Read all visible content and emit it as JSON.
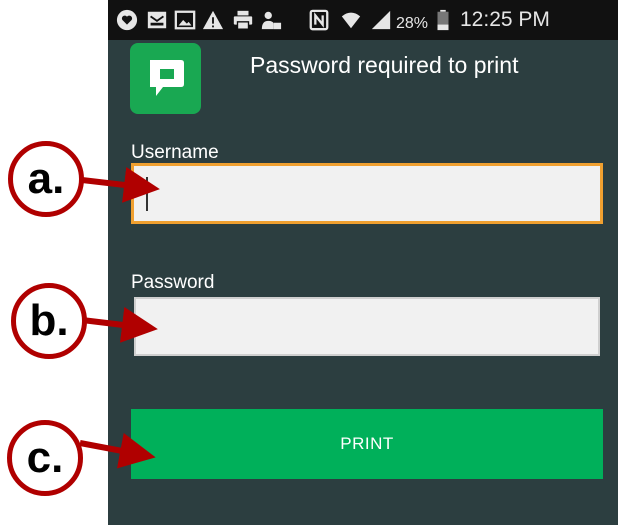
{
  "status_bar": {
    "battery": "28%",
    "time": "12:25 PM",
    "icons": [
      "heart-icon",
      "mail-icon",
      "gallery-icon",
      "warning-icon",
      "printer-icon",
      "lock-icon",
      "nfc-icon",
      "wifi-icon",
      "signal-icon",
      "battery-icon"
    ]
  },
  "dialog": {
    "title": "Password required to print",
    "username_label": "Username",
    "username_value": "",
    "password_label": "Password",
    "password_value": "",
    "print_label": "PRINT"
  },
  "annotations": {
    "a": "a.",
    "b": "b.",
    "c": "c."
  },
  "colors": {
    "background": "#2c3e40",
    "accent_green": "#00b05a",
    "logo_green": "#19a852",
    "focus_orange": "#f0a030",
    "annotation_red": "#b00000"
  }
}
